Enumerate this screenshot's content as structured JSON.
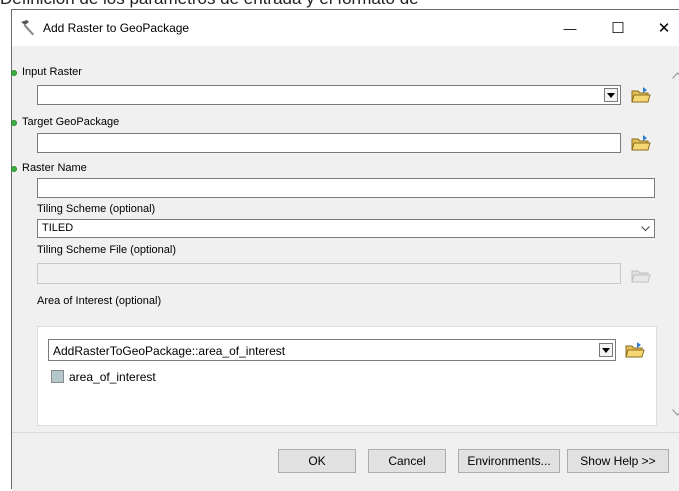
{
  "background_text": "Definición de los parámetros de entrada y el formato de",
  "window": {
    "title": "Add Raster to GeoPackage",
    "minimize_glyph": "—",
    "maximize_glyph": "☐",
    "close_glyph": "✕"
  },
  "fields": {
    "input_raster": {
      "label": "Input Raster",
      "value": ""
    },
    "target_geopackage": {
      "label": "Target GeoPackage",
      "value": ""
    },
    "raster_name": {
      "label": "Raster Name",
      "value": ""
    },
    "tiling_scheme": {
      "label": "Tiling Scheme (optional)",
      "value": "TILED"
    },
    "tiling_scheme_file": {
      "label": "Tiling Scheme File (optional)",
      "value": ""
    },
    "area_of_interest": {
      "label": "Area of Interest (optional)",
      "value": "AddRasterToGeoPackage::area_of_interest",
      "legend_label": "area_of_interest"
    }
  },
  "buttons": {
    "ok": "OK",
    "cancel": "Cancel",
    "environments": "Environments...",
    "show_help": "Show Help >>"
  },
  "colors": {
    "required_dot": "#3cb043",
    "legend_swatch": "#b4c8cc"
  }
}
